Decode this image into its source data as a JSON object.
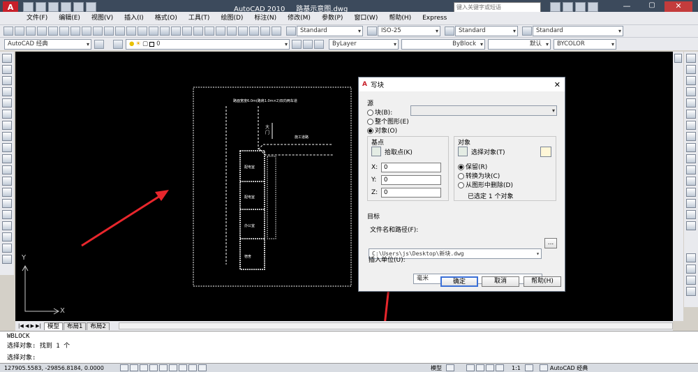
{
  "window": {
    "app": "AutoCAD 2010",
    "document": "路基示意图.dwg",
    "search_placeholder": "键入关键字或短语"
  },
  "menu": [
    "文件(F)",
    "编辑(E)",
    "视图(V)",
    "插入(I)",
    "格式(O)",
    "工具(T)",
    "绘图(D)",
    "标注(N)",
    "修改(M)",
    "参数(P)",
    "窗口(W)",
    "帮助(H)",
    "Express"
  ],
  "styles": {
    "text_style": "Standard",
    "dim_style": "ISO-25",
    "table_style": "Standard",
    "multileader_style": "Standard"
  },
  "workspace": "AutoCAD 经典",
  "layer": {
    "current": "0"
  },
  "properties": {
    "color": "ByLayer",
    "linetype": "ByBlock",
    "lineweight": "默认",
    "plotstyle": "BYCOLOR"
  },
  "drawing": {
    "top_note": "路面宽度6.0m(路肩1.0m×2)双向两车道",
    "gate_label": "大\n门",
    "right_label": "施工道路",
    "rooms": [
      "配电室",
      "配电室",
      "办公室",
      "宿舍"
    ]
  },
  "ucs": {
    "x": "X",
    "y": "Y"
  },
  "layout_tabs": [
    "模型",
    "布局1",
    "布局2"
  ],
  "dialog": {
    "title": "写块",
    "source": {
      "label": "源",
      "options": [
        "块(B):",
        "整个图形(E)",
        "对象(O)"
      ],
      "selected": 2
    },
    "base_point": {
      "label": "基点",
      "pick_button": "拾取点(K)",
      "x_label": "X:",
      "x_value": "0",
      "y_label": "Y:",
      "y_value": "0",
      "z_label": "Z:",
      "z_value": "0"
    },
    "objects": {
      "label": "对象",
      "select_button": "选择对象(T)",
      "options": [
        "保留(R)",
        "转换为块(C)",
        "从图形中删除(D)"
      ],
      "selected": 0,
      "status": "已选定 1 个对象"
    },
    "destination": {
      "label": "目标",
      "path_label": "文件名和路径(F):",
      "path_value": "C:\\Users\\js\\Desktop\\新块.dwg",
      "browse": "...",
      "units_label": "插入单位(U):",
      "units_value": "毫米"
    },
    "buttons": {
      "ok": "确定",
      "cancel": "取消",
      "help": "帮助(H)"
    }
  },
  "command": {
    "line1": "WBLOCK",
    "line2": "选择对象: 找到 1 个",
    "prompt": "选择对象:"
  },
  "status": {
    "coords": "127905.5583, -29856.8184, 0.0000",
    "model": "模型",
    "scale": "1:1",
    "workspace": "AutoCAD 经典"
  },
  "colors": {
    "canvas": "#000000",
    "arrow": "#e8262c",
    "titlebar": "#3c4a5c"
  }
}
